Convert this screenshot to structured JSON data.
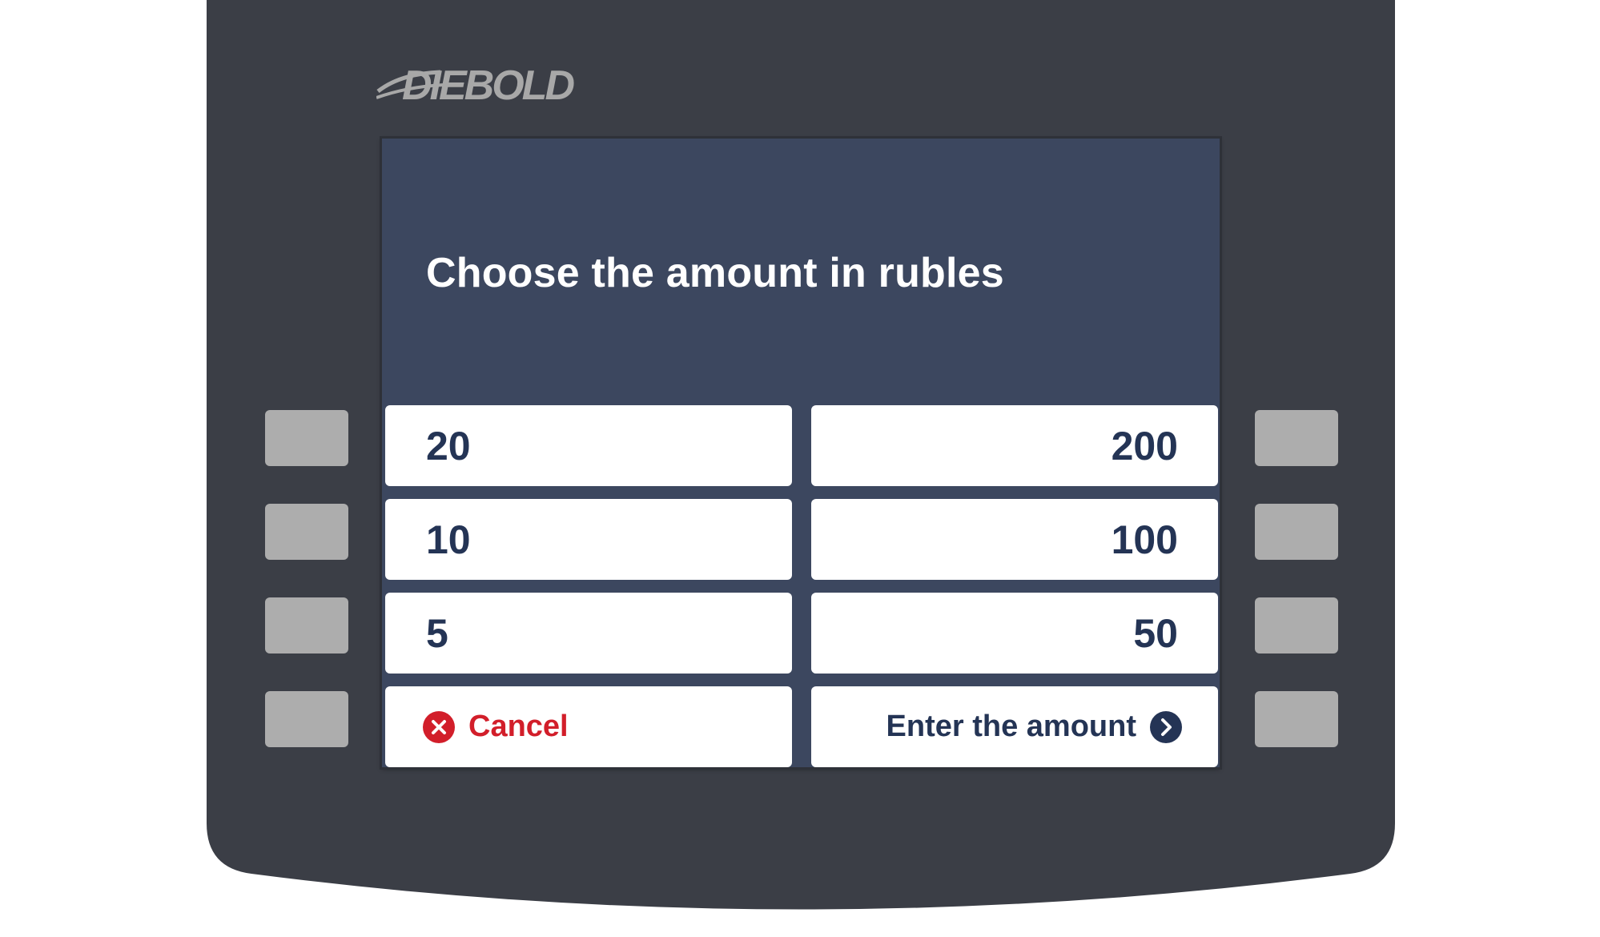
{
  "brand": {
    "logo_text": "DIEBOLD"
  },
  "screen": {
    "title": "Choose the amount in rubles",
    "left_options": [
      "20",
      "10",
      "5"
    ],
    "right_options": [
      "200",
      "100",
      "50"
    ],
    "cancel_label": "Cancel",
    "enter_amount_label": "Enter the amount"
  },
  "icons": {
    "cancel": "close-circle-icon",
    "enter": "chevron-right-circle-icon"
  },
  "colors": {
    "atm_body": "#3b3e46",
    "screen_background": "#3c475f",
    "option_background": "#ffffff",
    "option_text": "#243455",
    "cancel_red": "#d21e2a",
    "side_key": "#adadad",
    "logo": "#a8a8a8"
  }
}
